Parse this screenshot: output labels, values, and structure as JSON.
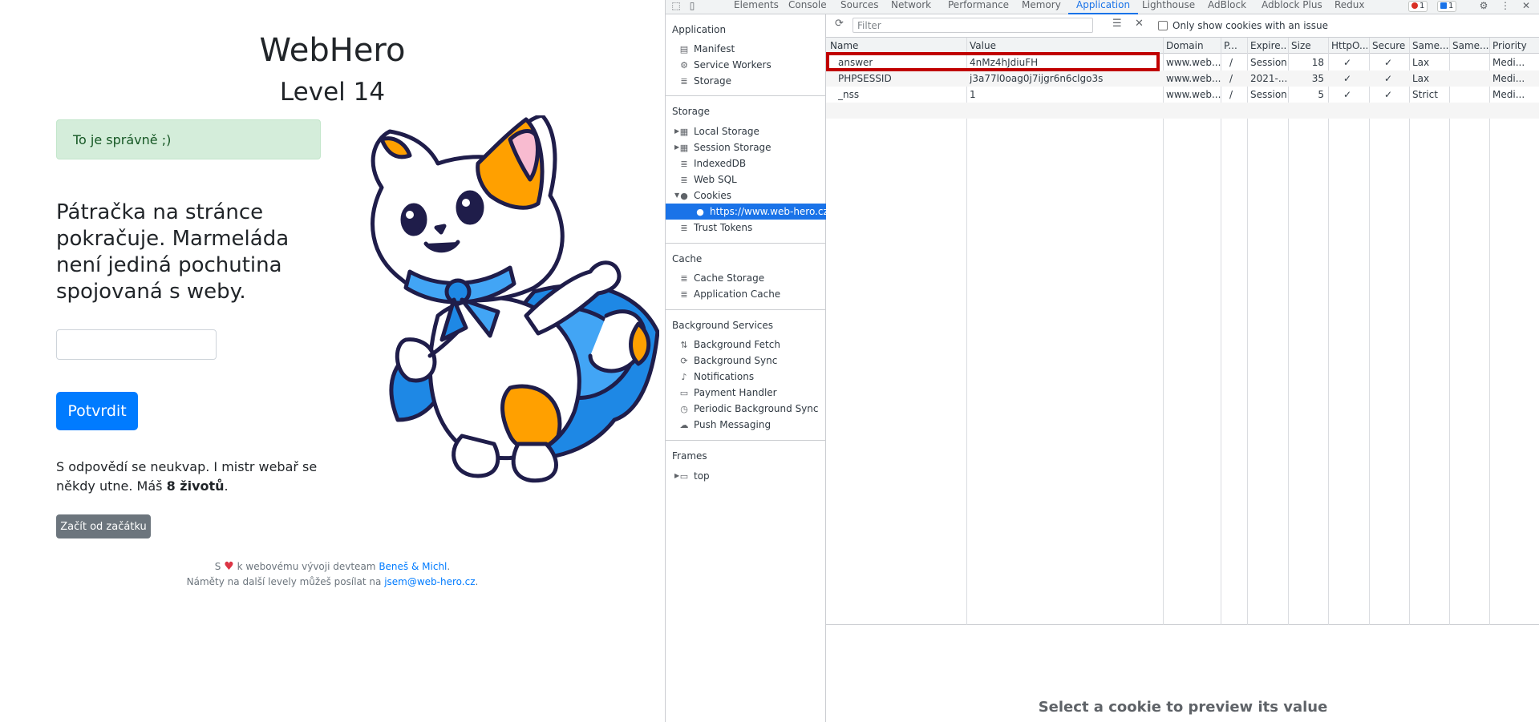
{
  "page": {
    "title": "WebHero",
    "level": "Level 14",
    "alert": "To je správně ;)",
    "question": "Pátračka na stránce pokračuje. Marmeláda není jediná pochutina spojovaná s weby.",
    "submit_label": "Potvrdit",
    "lives_text_1": "S odpovědí se neukvap. I mistr webař se někdy utne. Máš ",
    "lives_bold": "8 životů",
    "lives_text_2": ".",
    "restart_label": "Začít od začátku",
    "footer_1_pre": "S",
    "footer_1_mid": "k webovému vývoji devteam",
    "footer_1_link": "Beneš & Michl",
    "footer_1_post": ".",
    "footer_2_pre": "Náměty na další levely můžeš posílat na",
    "footer_2_link": "jsem@web-hero.cz",
    "footer_2_post": "."
  },
  "devtools": {
    "tabs": [
      "Elements",
      "Console",
      "Sources",
      "Network",
      "Performance",
      "Memory",
      "Application",
      "Lighthouse",
      "AdBlock",
      "Adblock Plus",
      "Redux"
    ],
    "active_tab": "Application",
    "error_count": "1",
    "message_count": "1",
    "sidebar": {
      "application_header": "Application",
      "application_items": [
        "Manifest",
        "Service Workers",
        "Storage"
      ],
      "storage_header": "Storage",
      "storage_items": [
        "Local Storage",
        "Session Storage",
        "IndexedDB",
        "Web SQL",
        "Cookies",
        "https://www.web-hero.cz",
        "Trust Tokens"
      ],
      "cache_header": "Cache",
      "cache_items": [
        "Cache Storage",
        "Application Cache"
      ],
      "bg_header": "Background Services",
      "bg_items": [
        "Background Fetch",
        "Background Sync",
        "Notifications",
        "Payment Handler",
        "Periodic Background Sync",
        "Push Messaging"
      ],
      "frames_header": "Frames",
      "frames_items": [
        "top"
      ]
    },
    "toolbar": {
      "filter_placeholder": "Filter",
      "only_issues_label": "Only show cookies with an issue"
    },
    "columns": [
      "Name",
      "Value",
      "Domain",
      "P...",
      "Expire...",
      "Size",
      "HttpO...",
      "Secure",
      "Same...",
      "Same...",
      "Priority"
    ],
    "rows": [
      [
        "answer",
        "4nMz4hJdiuFH",
        "www.web...",
        "/",
        "Session",
        "18",
        "✓",
        "✓",
        "Lax",
        "",
        "Medi..."
      ],
      [
        "PHPSESSID",
        "j3a77l0oag0j7ijgr6n6clgo3s",
        "www.web...",
        "/",
        "2021-...",
        "35",
        "✓",
        "✓",
        "Lax",
        "",
        "Medi..."
      ],
      [
        "_nss",
        "1",
        "www.web...",
        "/",
        "Session",
        "5",
        "✓",
        "✓",
        "Strict",
        "",
        "Medi..."
      ]
    ],
    "preview_text": "Select a cookie to preview its value",
    "colors": {
      "accent": "#1a73e8",
      "highlight": "#c00000",
      "alert_bg": "#d4edda",
      "primary_button": "#007bff"
    }
  }
}
